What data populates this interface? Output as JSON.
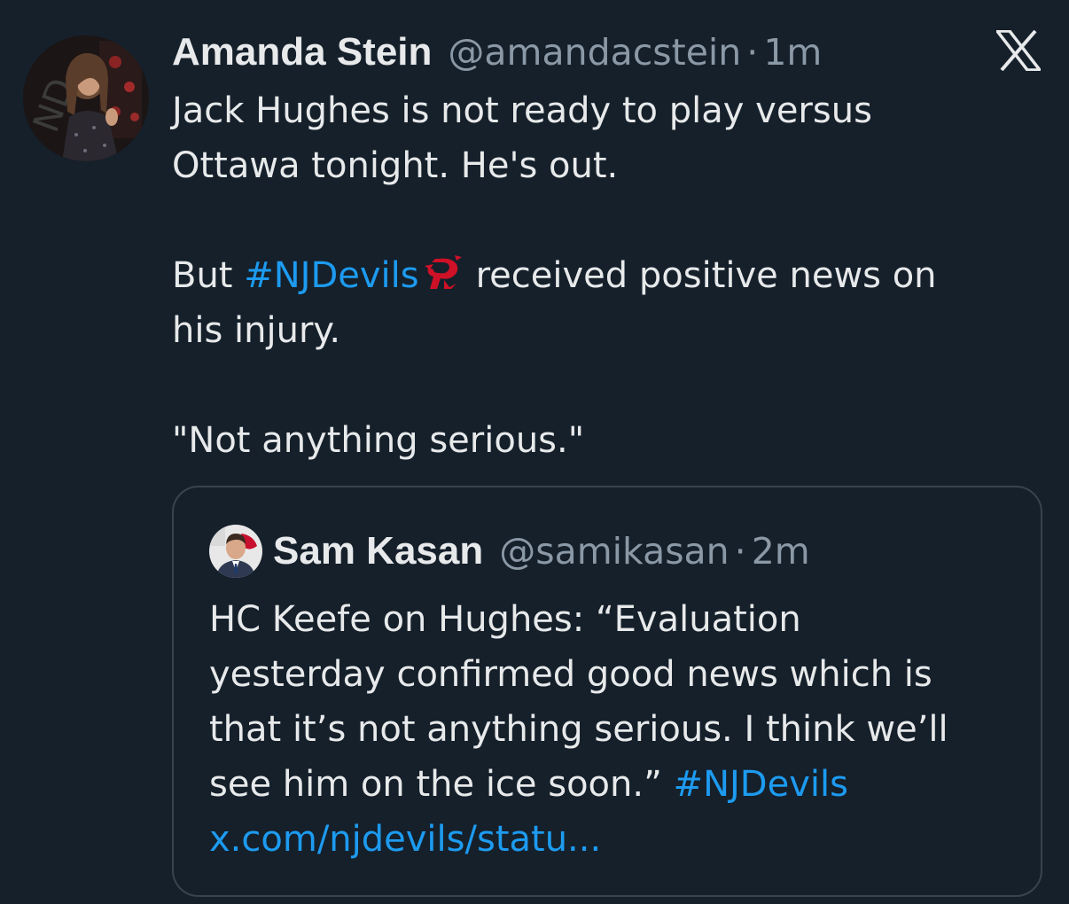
{
  "post": {
    "author_name": "Amanda Stein",
    "author_handle": "@amandacstein",
    "separator": "·",
    "time": "1m",
    "line1": "Jack Hughes is not ready to play versus",
    "line2": "Ottawa tonight. He's out.",
    "line3_prefix": "But ",
    "hashtag": "#NJDevils",
    "line3_suffix": "received positive news on",
    "line4": "his injury.",
    "line5": "\"Not anything serious.\"",
    "emoji": "nj-devils-logo-emoji"
  },
  "quoted_post": {
    "author_name": "Sam Kasan",
    "author_handle": "@samikasan",
    "separator": "·",
    "time": "2m",
    "line1": "HC Keefe on Hughes: “Evaluation",
    "line2": "yesterday confirmed good news which is",
    "line3": "that it’s not anything serious. I think we’ll",
    "line4_text": "see him on the ice soon.” ",
    "hashtag": "#NJDevils",
    "link": "x.com/njdevils/statu..."
  },
  "icons": {
    "brand": "x-logo-icon",
    "avatar": "amanda-stein-avatar",
    "quote_avatar": "sam-kasan-avatar"
  },
  "colors": {
    "background": "#15202b",
    "text": "#e7e9ea",
    "secondary": "#8b98a5",
    "link": "#1d9bf0",
    "border": "#38444d",
    "devils_red": "#ce1126"
  }
}
